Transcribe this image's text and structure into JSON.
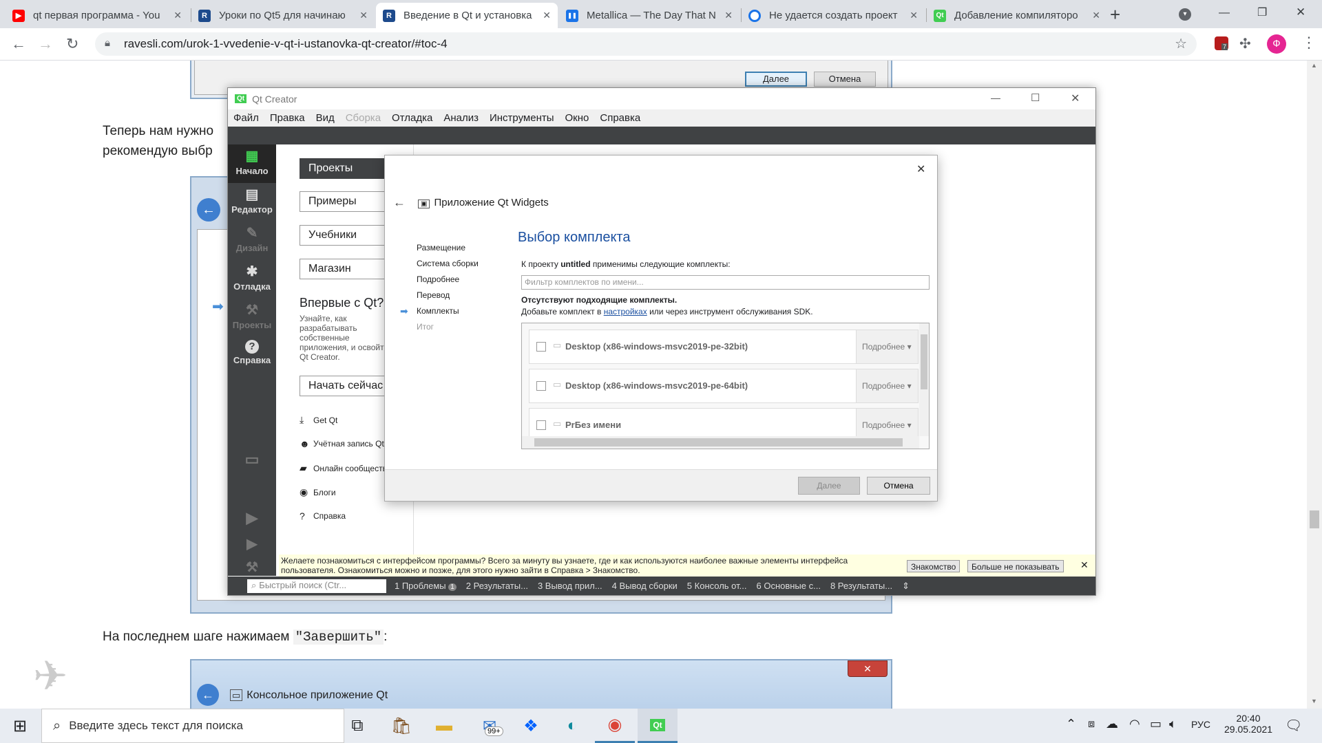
{
  "browser": {
    "tabs": [
      {
        "title": "qt первая программа - You",
        "icon_color": "#ff0000",
        "icon": "youtube-icon",
        "glyph": "▶"
      },
      {
        "title": "Уроки по Qt5 для начинаю",
        "icon_color": "#1d4a8c",
        "icon": "ravesli-icon",
        "glyph": "R"
      },
      {
        "title": "Введение в Qt и установка",
        "icon_color": "#1d4a8c",
        "icon": "ravesli-icon",
        "glyph": "R"
      },
      {
        "title": "Metallica — The Day That N",
        "icon_color": "#1a73e8",
        "icon": "pause-icon",
        "glyph": "❚❚"
      },
      {
        "title": "Не удается создать проект",
        "icon_color": "#1a73e8",
        "icon": "site-icon",
        "glyph": "o"
      },
      {
        "title": "Добавление компиляторо",
        "icon_color": "#41cd52",
        "icon": "qt-icon",
        "glyph": "Qt"
      }
    ],
    "url": "ravesli.com/urok-1-vvedenie-v-qt-i-ustanovka-qt-creator/#toc-4",
    "profile_letter": "Ф",
    "ext_badge": "7"
  },
  "page": {
    "para1_a": "Теперь нам нужно",
    "para1_b": "рекомендую выбр",
    "final_text": "На последнем шаге нажимаем",
    "final_code": "\"Завершить\"",
    "final_colon": ":",
    "top_next": "Далее",
    "top_cancel": "Отмена",
    "bottom_title": "Консольное приложение Qt"
  },
  "qt": {
    "title": "Qt Creator",
    "menu": [
      "Файл",
      "Правка",
      "Вид",
      "Сборка",
      "Отладка",
      "Анализ",
      "Инструменты",
      "Окно",
      "Справка"
    ],
    "modes": [
      {
        "label": "Начало",
        "icon": "grid-icon",
        "glyph": "▦",
        "dim": false
      },
      {
        "label": "Редактор",
        "icon": "editor-icon",
        "glyph": "▤",
        "dim": false
      },
      {
        "label": "Дизайн",
        "icon": "design-icon",
        "glyph": "✎",
        "dim": true
      },
      {
        "label": "Отладка",
        "icon": "bug-icon",
        "glyph": "✱",
        "dim": false
      },
      {
        "label": "Проекты",
        "icon": "wrench-icon",
        "glyph": "⚒",
        "dim": true
      },
      {
        "label": "Справка",
        "icon": "help-icon",
        "glyph": "?",
        "dim": false
      }
    ],
    "welcome": {
      "projects": "Проекты",
      "examples": "Примеры",
      "tutorials": "Учебники",
      "store": "Магазин",
      "first_time": "Впервые с Qt?",
      "intro": "Узнайте, как разрабатывать собственные приложения, и освойте Qt Creator.",
      "start": "Начать сейчас",
      "links": [
        {
          "label": "Get Qt",
          "icon": "download-icon",
          "glyph": "⤓"
        },
        {
          "label": "Учётная запись Qt",
          "icon": "user-icon",
          "glyph": "☻"
        },
        {
          "label": "Онлайн сообщество",
          "icon": "chat-icon",
          "glyph": "▰"
        },
        {
          "label": "Блоги",
          "icon": "rss-icon",
          "glyph": "◉"
        },
        {
          "label": "Справка",
          "icon": "help-icon",
          "glyph": "?"
        }
      ]
    },
    "infobar": {
      "text": "Желаете познакомиться с интерфейсом программы? Всего за минуту вы узнаете, где и как используются наиболее важные элементы интерфейса пользователя. Ознакомиться можно и позже, для этого нужно зайти в Справка > Знакомство.",
      "tour": "Знакомство",
      "dont_show": "Больше не показывать"
    },
    "status": {
      "search_placeholder": "Быстрый поиск (Ctr...",
      "items": [
        "1  Проблемы",
        "2  Результаты...",
        "3  Вывод прил...",
        "4  Вывод сборки",
        "5  Консоль от...",
        "6  Основные с...",
        "8  Результаты..."
      ],
      "problems_badge": "1"
    }
  },
  "wizard": {
    "header": "Приложение Qt Widgets",
    "steps": [
      "Размещение",
      "Система сборки",
      "Подробнее",
      "Перевод",
      "Комплекты",
      "Итог"
    ],
    "current_step": "Комплекты",
    "title": "Выбор комплекта",
    "intro_pre": "К проекту",
    "intro_bold": "untitled",
    "intro_post": "применимы следующие комплекты:",
    "filter_placeholder": "Фильтр комплектов по имени...",
    "warning": "Отсутствуют подходящие комплекты.",
    "hint_pre": "Добавьте комплект в",
    "hint_link": "настройках",
    "hint_post": "или через инструмент обслуживания SDK.",
    "kits": [
      {
        "name": "Desktop (x86-windows-msvc2019-pe-32bit)",
        "details": "Подробнее"
      },
      {
        "name": "Desktop (x86-windows-msvc2019-pe-64bit)",
        "details": "Подробнее"
      },
      {
        "name": "PrБез имени",
        "details": "Подробнее"
      }
    ],
    "next": "Далее",
    "cancel": "Отмена",
    "accent": "#1a4fa0"
  },
  "taskbar": {
    "search_placeholder": "Введите здесь текст для поиска",
    "mail_badge": "99+",
    "lang": "РУС",
    "time": "20:40",
    "date": "29.05.2021"
  }
}
